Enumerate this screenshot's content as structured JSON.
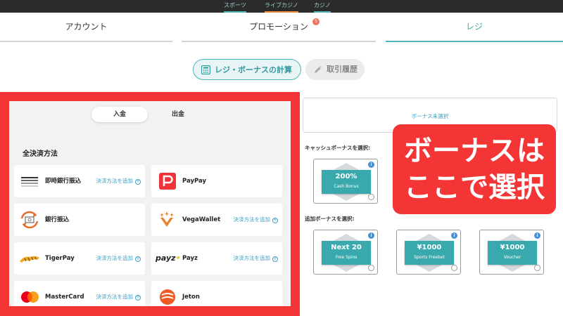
{
  "top_nav": [
    {
      "label": "スポーツ",
      "color": "#4fb5b9"
    },
    {
      "label": "ライブカジノ",
      "color": "#f08a3c"
    },
    {
      "label": "カジノ",
      "color": "#4fb5b9"
    }
  ],
  "tabs": {
    "account": "アカウント",
    "promotion": "プロモーション",
    "promotion_badge": "5",
    "cashier": "レジ",
    "active": "cashier"
  },
  "pills": {
    "calc": "レジ・ボーナスの計算",
    "history": "取引履歴"
  },
  "payment": {
    "deposit": "入金",
    "withdraw": "出金",
    "section_title": "全決済方法",
    "add_label": "決済方法を追加",
    "methods": [
      {
        "name": "即時銀行振込",
        "icon": "stripes-icon",
        "add": true
      },
      {
        "name": "PayPay",
        "icon": "paypay-icon",
        "add": false
      },
      {
        "name": "銀行振込",
        "icon": "bank-transfer-icon",
        "add": false
      },
      {
        "name": "VegaWallet",
        "icon": "vegawallet-icon",
        "add": true
      },
      {
        "name": "TigerPay",
        "icon": "tigerpay-icon",
        "add": true
      },
      {
        "name": "Payz",
        "icon": "payz-icon",
        "logo_text": "payz",
        "add": true
      },
      {
        "name": "MasterCard",
        "icon": "mastercard-icon",
        "add": true
      },
      {
        "name": "Jeton",
        "icon": "jeton-icon",
        "add": false
      }
    ]
  },
  "bonus": {
    "none_selected": "ボーナス未選択",
    "cash_label": "キャッシュボーナスを選択:",
    "cash": {
      "big": "200%",
      "small": "Cash Bonus"
    },
    "extra_label": "追加ボーナスを選択:",
    "extra": [
      {
        "big": "Next 20",
        "small": "Free Spins"
      },
      {
        "big": "¥1000",
        "small": "Sports Freebet"
      },
      {
        "big": "¥1000",
        "small": "Voucher"
      }
    ]
  },
  "callout": {
    "line1": "ボーナスは",
    "line2": "ここで選択"
  },
  "colors": {
    "accent": "#4fb5b9",
    "highlight_red": "#f33535",
    "link_blue": "#3a9fc4"
  }
}
